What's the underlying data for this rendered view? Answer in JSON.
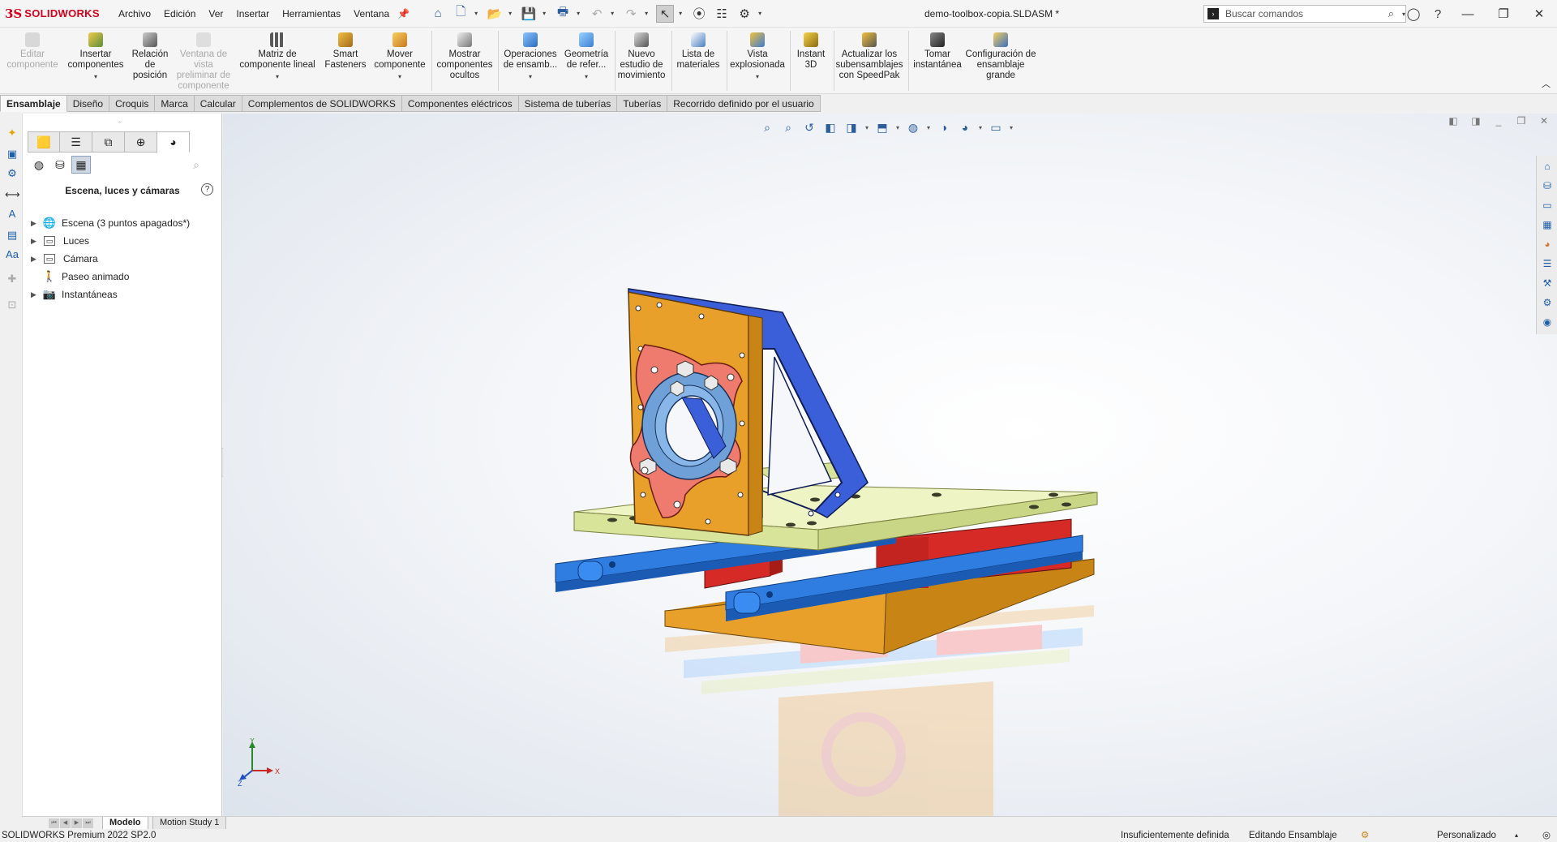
{
  "app": {
    "logo_ds": "3S",
    "logo_name": "SOLIDWORKS",
    "document_title": "demo-toolbox-copia.SLDASM *"
  },
  "menu": [
    "Archivo",
    "Edición",
    "Ver",
    "Insertar",
    "Herramientas",
    "Ventana"
  ],
  "search": {
    "placeholder": "Buscar comandos"
  },
  "ribbon": [
    {
      "label": "Editar componente",
      "enabled": false,
      "icon": "edit-component-icon"
    },
    {
      "label": "Insertar componentes",
      "enabled": true,
      "icon": "insert-components-icon"
    },
    {
      "label": "Relación de posición",
      "enabled": true,
      "icon": "mate-icon"
    },
    {
      "label": "Ventana de vista preliminar de componente",
      "enabled": false,
      "icon": "component-preview-icon"
    },
    {
      "label": "Matriz de componente lineal",
      "enabled": true,
      "icon": "linear-pattern-icon"
    },
    {
      "label": "Smart Fasteners",
      "enabled": true,
      "icon": "smart-fasteners-icon"
    },
    {
      "label": "Mover componente",
      "enabled": true,
      "icon": "move-component-icon"
    },
    {
      "label": "Mostrar componentes ocultos",
      "enabled": true,
      "icon": "show-hidden-icon"
    },
    {
      "label": "Operaciones de ensamb...",
      "enabled": true,
      "icon": "assembly-features-icon"
    },
    {
      "label": "Geometría de refer...",
      "enabled": true,
      "icon": "reference-geometry-icon"
    },
    {
      "label": "Nuevo estudio de movimiento",
      "enabled": true,
      "icon": "motion-study-icon"
    },
    {
      "label": "Lista de materiales",
      "enabled": true,
      "icon": "bom-icon"
    },
    {
      "label": "Vista explosionada",
      "enabled": true,
      "icon": "exploded-view-icon"
    },
    {
      "label": "Instant 3D",
      "enabled": true,
      "icon": "instant3d-icon"
    },
    {
      "label": "Actualizar los subensamblajes con SpeedPak",
      "enabled": true,
      "icon": "speedpak-icon"
    },
    {
      "label": "Tomar instantánea",
      "enabled": true,
      "icon": "snapshot-icon"
    },
    {
      "label": "Configuración de ensamblaje grande",
      "enabled": true,
      "icon": "large-assembly-icon"
    }
  ],
  "tabs": [
    "Ensamblaje",
    "Diseño",
    "Croquis",
    "Marca",
    "Calcular",
    "Complementos de SOLIDWORKS",
    "Componentes eléctricos",
    "Sistema de tuberías",
    "Tuberías",
    "Recorrido definido por el usuario"
  ],
  "panel": {
    "title": "Escena, luces y cámaras",
    "tree": [
      {
        "label": "Escena (3 puntos apagados*)",
        "expandable": true,
        "icon": "scene-icon"
      },
      {
        "label": "Luces",
        "expandable": true,
        "icon": "lights-folder-icon"
      },
      {
        "label": "Cámara",
        "expandable": true,
        "icon": "camera-folder-icon"
      },
      {
        "label": "Paseo animado",
        "expandable": false,
        "icon": "walkthrough-icon"
      },
      {
        "label": "Instantáneas",
        "expandable": true,
        "icon": "snapshots-icon"
      }
    ]
  },
  "bottom_tabs": [
    "Modelo",
    "Motion Study 1"
  ],
  "triad": {
    "x": "X",
    "y": "Y",
    "z": "Z"
  },
  "status": {
    "version": "SOLIDWORKS Premium 2022 SP2.0",
    "definition": "Insuficientemente definida",
    "editing": "Editando Ensamblaje",
    "units": "Personalizado"
  },
  "colors": {
    "accent_red": "#d6001c",
    "plate_orange": "#e8a02a",
    "rail_blue": "#2f7de0",
    "frame_blue": "#3b5fd9",
    "flange_salmon": "#ef7b6e",
    "carriage_red": "#d52a26",
    "top_plate_lime": "#e3eea6"
  }
}
